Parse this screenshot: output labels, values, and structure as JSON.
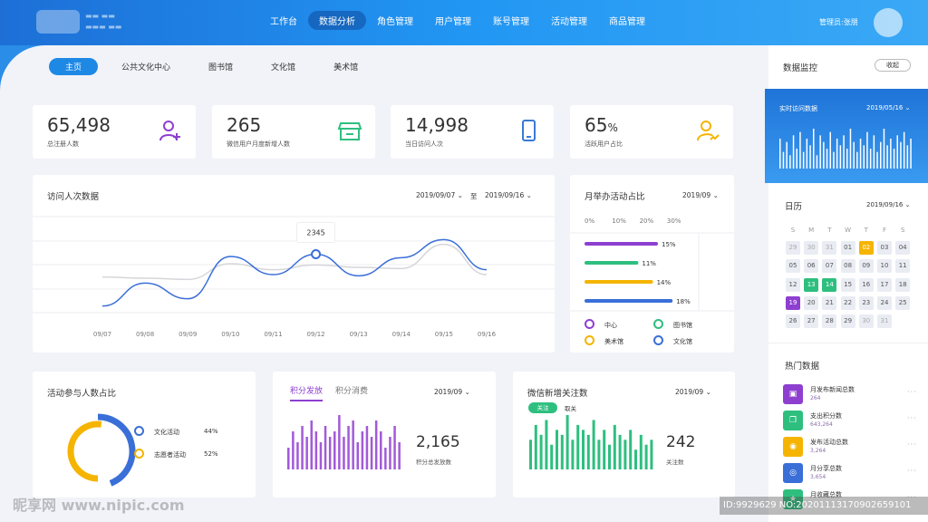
{
  "header": {
    "nav": [
      "工作台",
      "数据分析",
      "角色管理",
      "用户管理",
      "账号管理",
      "活动管理",
      "商品管理"
    ],
    "active_nav": "数据分析",
    "admin_label": "管理员:张朋"
  },
  "tabs": [
    "主页",
    "公共文化中心",
    "图书馆",
    "文化馆",
    "美术馆"
  ],
  "stats": [
    {
      "value": "65,498",
      "unit": "",
      "label": "总注册人数",
      "icon": "user-add-icon",
      "color": "#8e3fd0"
    },
    {
      "value": "265",
      "unit": "",
      "label": "微信用户月度新增人数",
      "icon": "store-icon",
      "color": "#2ebf7f"
    },
    {
      "value": "14,998",
      "unit": "",
      "label": "当日访问人次",
      "icon": "phone-icon",
      "color": "#3a7bd5"
    },
    {
      "value": "65",
      "unit": "%",
      "label": "活跃用户占比",
      "icon": "user-chart-icon",
      "color": "#f5b400"
    }
  ],
  "visits": {
    "title": "访问人次数据",
    "date_from": "2019/09/07",
    "to_label": "至",
    "date_to": "2019/09/16",
    "tooltip": "2345"
  },
  "monthly": {
    "title": "月举办活动占比",
    "month": "2019/09",
    "legend": [
      {
        "name": "中心",
        "color": "#8e3fd0"
      },
      {
        "name": "图书馆",
        "color": "#2ebf7f"
      },
      {
        "name": "美术馆",
        "color": "#f5b400"
      },
      {
        "name": "文化馆",
        "color": "#3a6fd8"
      }
    ]
  },
  "participation": {
    "title": "活动参与人数占比",
    "items": [
      {
        "name": "文化活动",
        "value": "44%",
        "color": "#3a6fd8"
      },
      {
        "name": "志愿者活动",
        "value": "52%",
        "color": "#f5b400"
      }
    ]
  },
  "points": {
    "tab_active": "积分发放",
    "tab_other": "积分消费",
    "month": "2019/09",
    "value": "2,165",
    "label": "积分总发放数"
  },
  "wechat": {
    "title": "微信新增关注数",
    "month": "2019/09",
    "btn_follow": "关注",
    "btn_unfollow": "取关",
    "value": "242",
    "label": "关注数"
  },
  "right": {
    "monitor_title": "数据监控",
    "collapse_label": "收起",
    "realtime_title": "实时访问数据",
    "realtime_date": "2019/05/16",
    "calendar_title": "日历",
    "calendar_date": "2019/09/16",
    "weekdays": [
      "S",
      "M",
      "T",
      "W",
      "T",
      "F",
      "S"
    ],
    "days": [
      "29",
      "30",
      "31",
      "01",
      "02",
      "03",
      "04",
      "05",
      "06",
      "07",
      "08",
      "09",
      "10",
      "11",
      "12",
      "13",
      "14",
      "15",
      "16",
      "17",
      "18",
      "19",
      "20",
      "21",
      "22",
      "23",
      "24",
      "25",
      "26",
      "27",
      "28",
      "29",
      "30",
      "31"
    ],
    "hot_title": "热门数据",
    "hot": [
      {
        "name": "月发布新闻总数",
        "value": "264",
        "color": "#8e3fd0",
        "icon": "calendar-check-icon"
      },
      {
        "name": "支出积分数",
        "value": "643,264",
        "color": "#2ebf7f",
        "icon": "copy-icon"
      },
      {
        "name": "发布活动总数",
        "value": "3,264",
        "color": "#f5b400",
        "icon": "gamepad-icon"
      },
      {
        "name": "月分享总数",
        "value": "3,654",
        "color": "#3a6fd8",
        "icon": "camera-icon"
      },
      {
        "name": "月收藏总数",
        "value": "",
        "color": "#2ebf7f",
        "icon": "star-icon"
      }
    ],
    "more": "···"
  },
  "chart_data": [
    {
      "type": "line",
      "title": "访问人次数据",
      "categories": [
        "09/07",
        "09/08",
        "09/09",
        "09/10",
        "09/11",
        "09/12",
        "09/13",
        "09/14",
        "09/15",
        "09/16"
      ],
      "series": [
        {
          "values": [
            200,
            1150,
            500,
            2250,
            1500,
            2345,
            1450,
            2200,
            2950,
            1700
          ]
        },
        {
          "values": [
            1400,
            1350,
            1300,
            1950,
            1700,
            1900,
            1800,
            1750,
            2750,
            1500
          ]
        }
      ],
      "highlight": {
        "category": "09/12",
        "value": 2345
      },
      "grid": true
    },
    {
      "type": "bar",
      "orientation": "horizontal",
      "title": "月举办活动占比",
      "x_ticks": [
        "0%",
        "10%",
        "20%",
        "30%"
      ],
      "xlim": [
        0,
        30
      ],
      "categories": [
        "中心",
        "图书馆",
        "美术馆",
        "文化馆"
      ],
      "values": [
        15,
        11,
        14,
        18
      ],
      "value_labels": [
        "15%",
        "11%",
        "14%",
        "18%"
      ]
    },
    {
      "type": "pie",
      "title": "活动参与人数占比",
      "categories": [
        "文化活动",
        "志愿者活动"
      ],
      "values": [
        44,
        52
      ]
    },
    {
      "type": "bar",
      "title": "积分发放",
      "values": [
        4,
        7,
        5,
        8,
        6,
        9,
        7,
        5,
        8,
        6,
        7,
        10,
        6,
        8,
        9,
        5,
        7,
        8,
        6,
        9,
        7,
        4,
        6,
        8,
        5
      ]
    },
    {
      "type": "bar",
      "title": "微信新增关注数",
      "values": [
        6,
        9,
        7,
        10,
        5,
        8,
        7,
        11,
        6,
        9,
        8,
        7,
        10,
        6,
        8,
        5,
        9,
        7,
        6,
        8,
        4,
        7,
        5,
        6
      ]
    },
    {
      "type": "bar",
      "title": "实时访问数据",
      "values": [
        9,
        5,
        8,
        4,
        10,
        6,
        11,
        5,
        9,
        7,
        12,
        4,
        10,
        8,
        6,
        11,
        5,
        9,
        7,
        10,
        6,
        12,
        8,
        5,
        9,
        7,
        11,
        6,
        10,
        5,
        8,
        12,
        7,
        9,
        6,
        10,
        8,
        11,
        7,
        9
      ]
    }
  ]
}
